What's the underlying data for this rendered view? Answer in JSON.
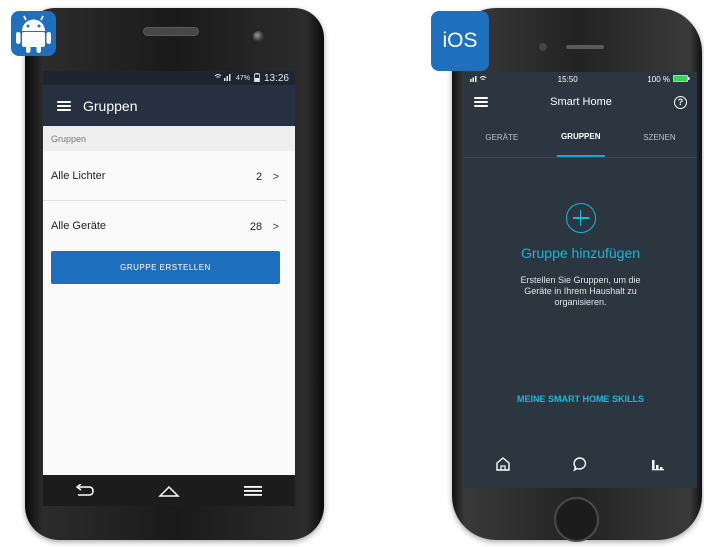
{
  "android": {
    "badge_icon": "android-robot-icon",
    "status": {
      "battery": "47%",
      "time": "13:26"
    },
    "appbar": {
      "title": "Gruppen"
    },
    "section_header": "Gruppen",
    "rows": [
      {
        "label": "Alle Lichter",
        "count": "2",
        "chevron": ">"
      },
      {
        "label": "Alle Geräte",
        "count": "28",
        "chevron": ">"
      }
    ],
    "button_label": "GRUPPE ERSTELLEN",
    "colors": {
      "appbar": "#273040",
      "button": "#1f6fbf"
    }
  },
  "ios": {
    "badge_label": "iOS",
    "status": {
      "time": "15:50",
      "battery": "100 %"
    },
    "bar_title": "Smart Home",
    "help_glyph": "?",
    "tabs": [
      {
        "label": "GERÄTE"
      },
      {
        "label": "GRUPPEN"
      },
      {
        "label": "SZENEN"
      }
    ],
    "active_tab": "GRUPPEN",
    "empty_heading": "Gruppe hinzufügen",
    "empty_description": "Erstellen Sie Gruppen, um die Geräte in Ihrem Haushalt zu organisieren.",
    "skills_link": "MEINE SMART HOME SKILLS",
    "bottom_nav_icons": [
      "home-icon",
      "chat-bubble-icon",
      "activity-icon"
    ],
    "colors": {
      "background": "#2b3640",
      "accent": "#1fb5d6"
    }
  }
}
